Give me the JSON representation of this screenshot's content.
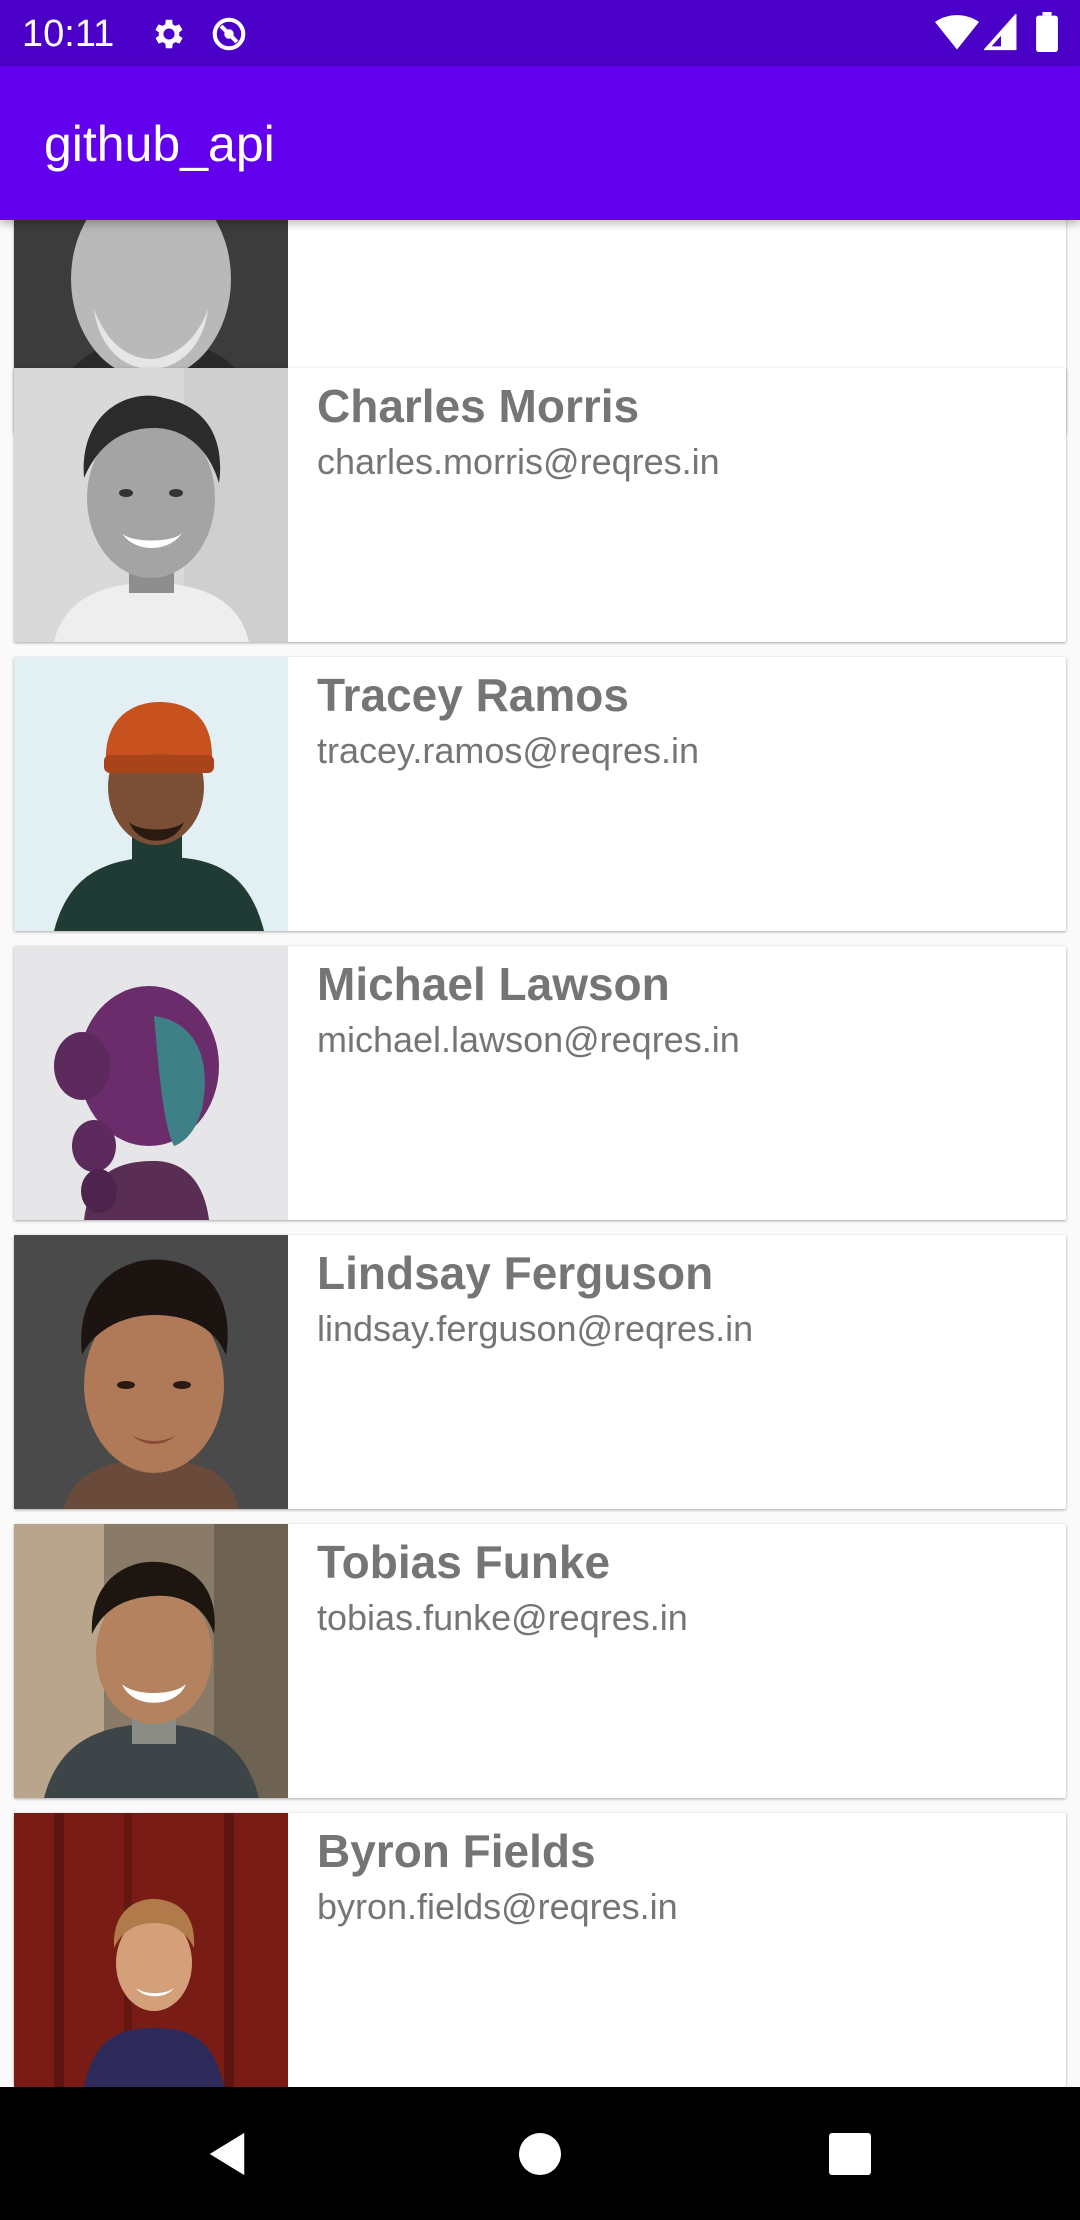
{
  "status_bar": {
    "time": "10:11",
    "left_icons": [
      "gear-icon",
      "data-saver-icon"
    ],
    "right_icons": [
      "wifi-icon",
      "signal-icon",
      "battery-icon"
    ],
    "background_color": "#4b00c8"
  },
  "app_bar": {
    "title": "github_api",
    "background_color": "#6200ee"
  },
  "users": [
    {
      "name": "",
      "email": "",
      "avatar": "older-man-bw-photo"
    },
    {
      "name": "Charles Morris",
      "email": "charles.morris@reqres.in",
      "avatar": "smiling-man-bw-photo"
    },
    {
      "name": "Tracey Ramos",
      "email": "tracey.ramos@reqres.in",
      "avatar": "man-orange-beanie-photo"
    },
    {
      "name": "Michael Lawson",
      "email": "michael.lawson@reqres.in",
      "avatar": "woman-purple-hair-profile-photo"
    },
    {
      "name": "Lindsay Ferguson",
      "email": "lindsay.ferguson@reqres.in",
      "avatar": "young-man-portrait-photo"
    },
    {
      "name": "Tobias Funke",
      "email": "tobias.funke@reqres.in",
      "avatar": "smiling-man-outdoor-photo"
    },
    {
      "name": "Byron Fields",
      "email": "byron.fields@reqres.in",
      "avatar": "man-red-wall-photo"
    }
  ],
  "nav_bar": {
    "buttons": [
      "back-icon",
      "home-icon",
      "recents-icon"
    ]
  }
}
